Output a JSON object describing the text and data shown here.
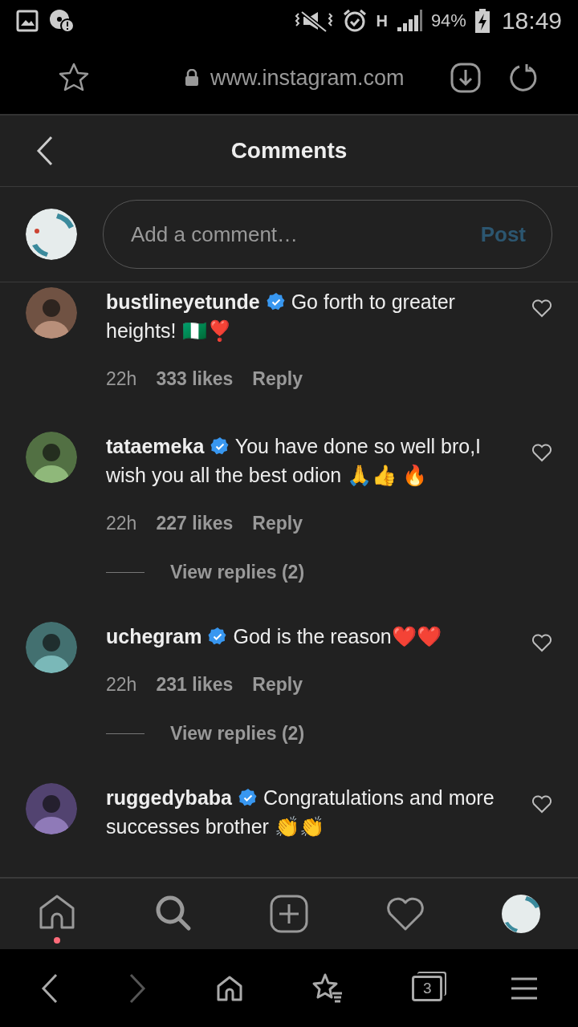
{
  "status_bar": {
    "network": "H",
    "battery": "94%",
    "time": "18:49"
  },
  "browser": {
    "url": "www.instagram.com",
    "tab_count": "3"
  },
  "header": {
    "title": "Comments"
  },
  "comment_box": {
    "placeholder": "Add a comment…",
    "post": {
      "label": "Post",
      "disabled": true
    }
  },
  "comments": [
    {
      "username": "bustlineyetunde",
      "verified": true,
      "text": "Go forth to greater heights! 🇳🇬❣️",
      "time": "22h",
      "likes": "333 likes",
      "reply": "Reply"
    },
    {
      "username": "tataemeka",
      "verified": true,
      "text": "You have done so well bro,I wish you all the best odion 🙏👍 🔥",
      "time": "22h",
      "likes": "227 likes",
      "reply": "Reply",
      "view_replies": "View replies (2)"
    },
    {
      "username": "uchegram",
      "verified": true,
      "text": "God is the reason❤️❤️",
      "time": "22h",
      "likes": "231 likes",
      "reply": "Reply",
      "view_replies": "View replies (2)"
    },
    {
      "username": "ruggedybaba",
      "verified": true,
      "text": "Congratulations and more successes brother 👏👏"
    }
  ],
  "bottom_nav": [
    {
      "kind": "home",
      "notification": true
    },
    {
      "kind": "search",
      "notification": false
    },
    {
      "kind": "add",
      "notification": false
    },
    {
      "kind": "activity",
      "notification": false
    },
    {
      "kind": "profile",
      "notification": false
    }
  ]
}
